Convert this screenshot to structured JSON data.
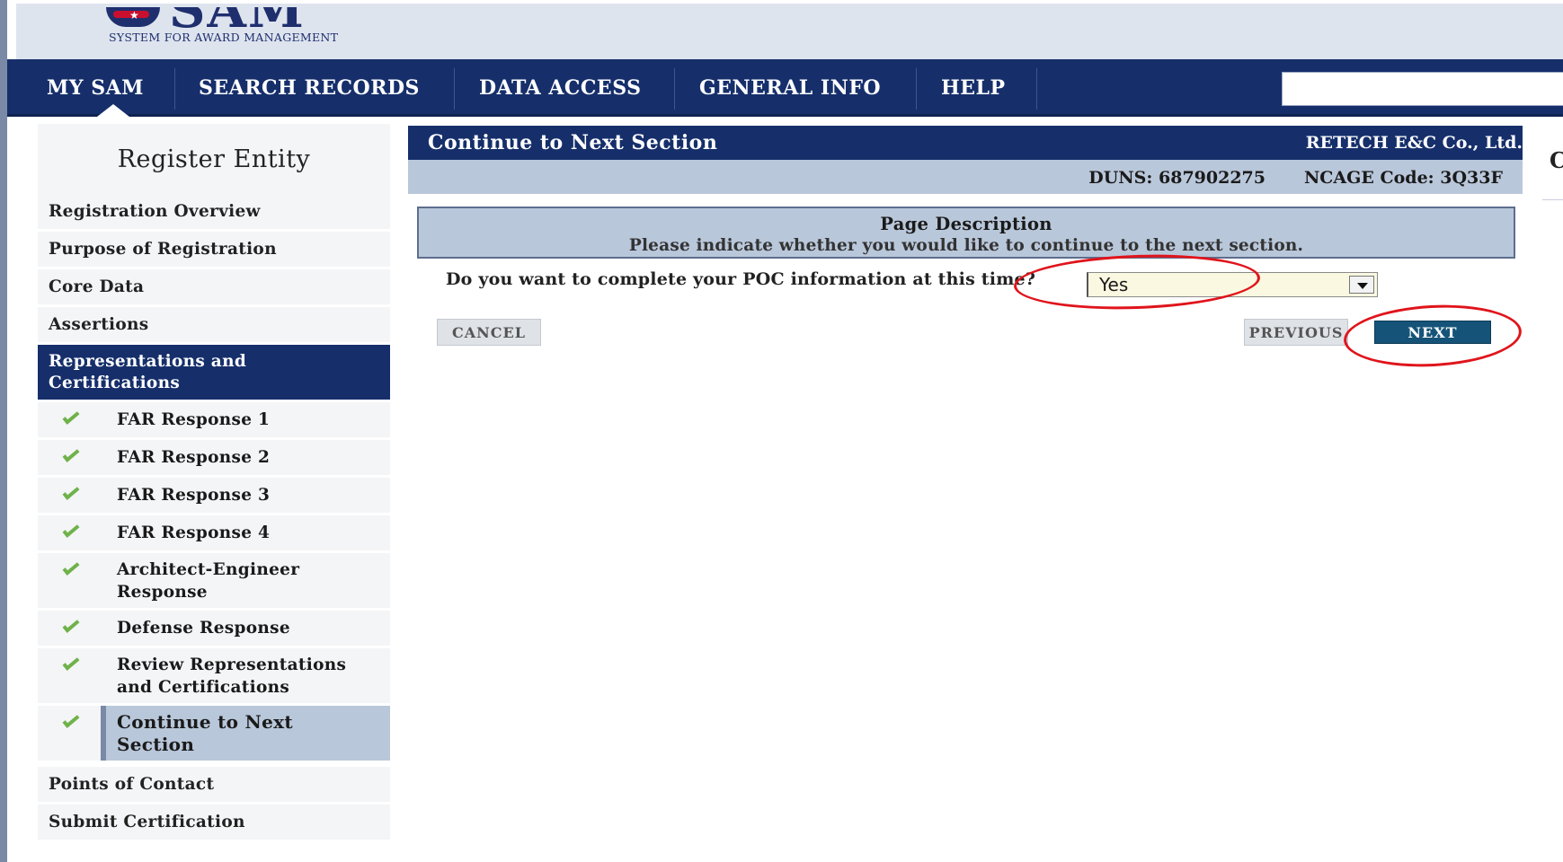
{
  "brand": {
    "logo_text": "SAM",
    "tagline": "SYSTEM FOR AWARD MANAGEMENT"
  },
  "topnav": {
    "items": [
      "MY SAM",
      "SEARCH RECORDS",
      "DATA ACCESS",
      "GENERAL INFO",
      "HELP"
    ],
    "search_placeholder": ""
  },
  "sidebar": {
    "title": "Register Entity",
    "items": [
      "Registration Overview",
      "Purpose of Registration",
      "Core Data",
      "Assertions",
      "Representations and Certifications"
    ],
    "subitems": [
      "FAR Response 1",
      "FAR Response 2",
      "FAR Response 3",
      "FAR Response 4",
      "Architect-Engineer Response",
      "Defense Response",
      "Review Representations and Certifications",
      "Continue to Next Section"
    ],
    "after_items": [
      "Points of Contact",
      "Submit Certification"
    ],
    "active_item": "Representations and Certifications",
    "current_subitem": "Continue to Next Section"
  },
  "main": {
    "section_title": "Continue to Next Section",
    "entity_name": "RETECH E&C Co., Ltd.",
    "duns": "DUNS:  687902275",
    "ncage": "NCAGE Code:  3Q33F",
    "side_peek": "C",
    "description": {
      "heading": "Page Description",
      "text": "Please indicate whether you would like to continue to the next section."
    },
    "question": "Do you want to complete your POC information at this time?",
    "answer": "Yes",
    "buttons": {
      "cancel": "CANCEL",
      "previous": "PREVIOUS",
      "next": "NEXT"
    }
  },
  "colors": {
    "nav": "#162f6b",
    "panel": "#b9c7da",
    "next_button": "#155478",
    "check": "#6fb24a",
    "annotation": "#e0141b"
  }
}
